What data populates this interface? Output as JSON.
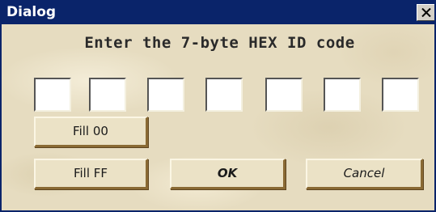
{
  "window": {
    "title": "Dialog",
    "close_label": "×"
  },
  "prompt": "Enter the 7-byte HEX ID code",
  "hex_fields": [
    {
      "value": ""
    },
    {
      "value": ""
    },
    {
      "value": ""
    },
    {
      "value": ""
    },
    {
      "value": ""
    },
    {
      "value": ""
    },
    {
      "value": ""
    }
  ],
  "buttons": {
    "fill00": "Fill 00",
    "fillff": "Fill FF",
    "ok": "OK",
    "cancel": "Cancel"
  },
  "colors": {
    "titlebar": "#0a246a",
    "background": "#e6dcc0",
    "button_face": "#ebe2c6",
    "button_shadow": "#8a6a34"
  },
  "icons": {
    "close": "close-icon"
  }
}
